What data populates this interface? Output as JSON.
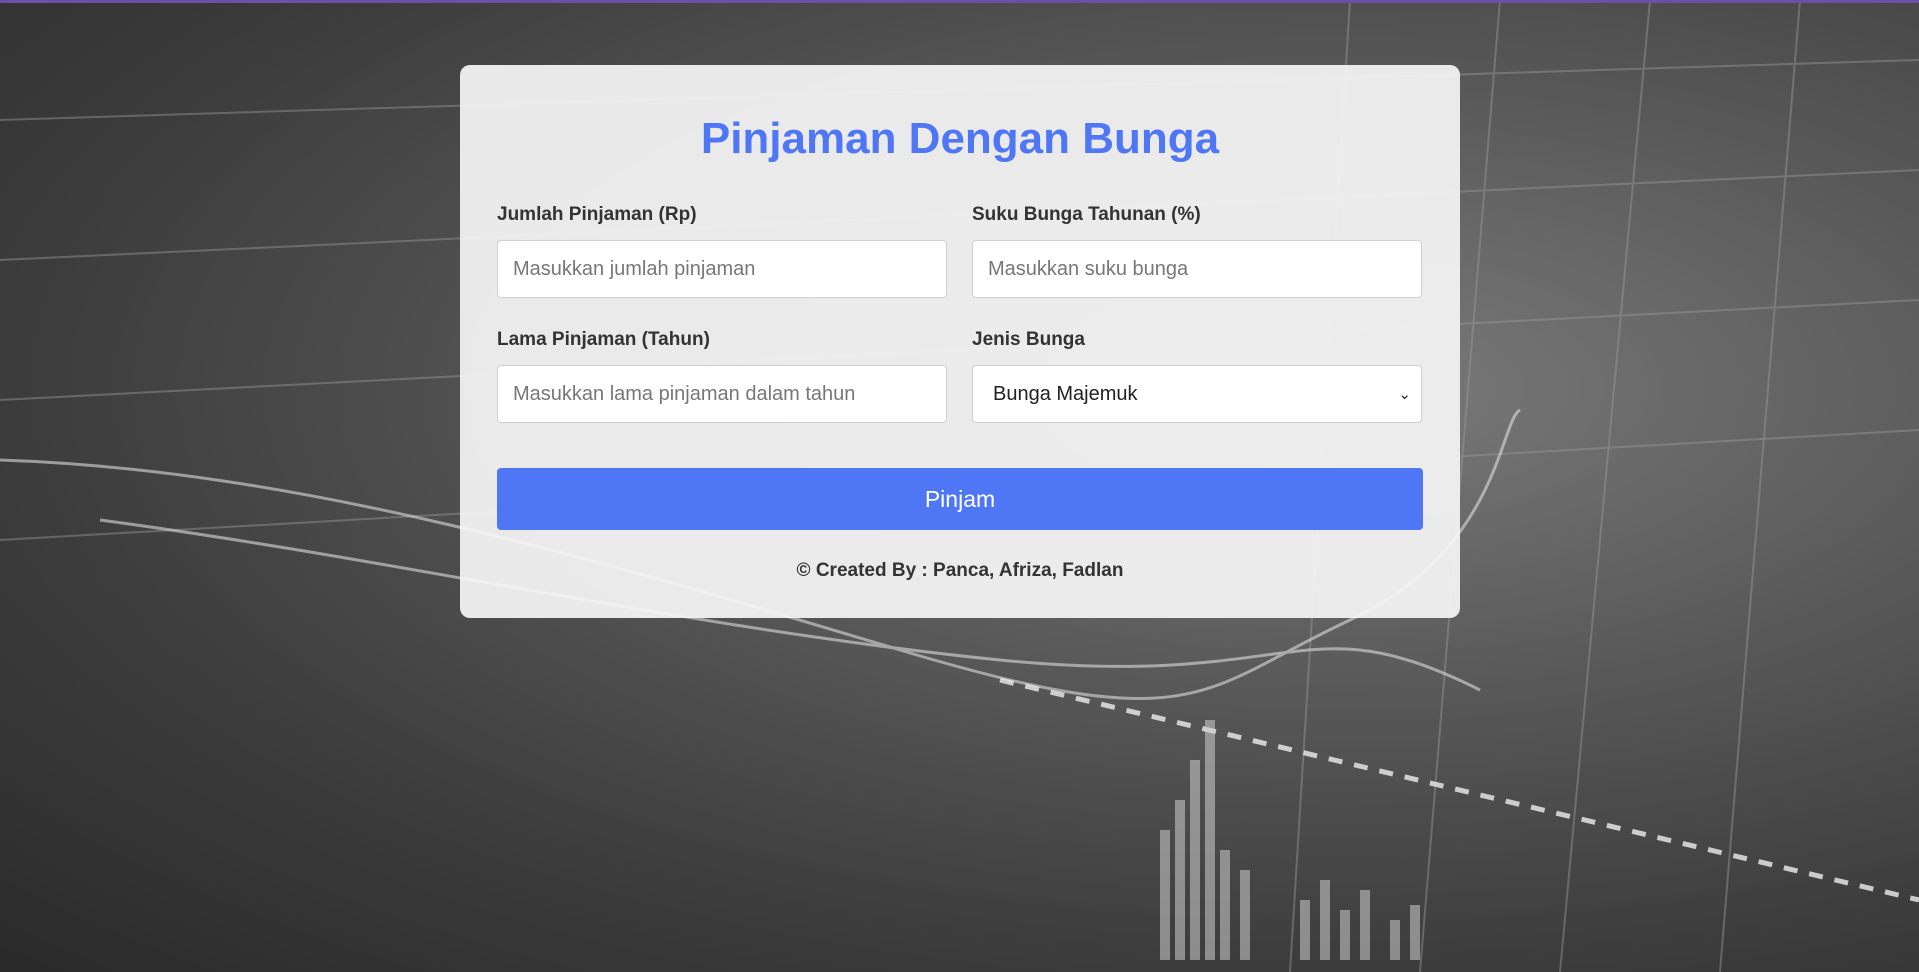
{
  "page": {
    "title": "Pinjaman Dengan Bunga"
  },
  "form": {
    "amount": {
      "label": "Jumlah Pinjaman (Rp)",
      "placeholder": "Masukkan jumlah pinjaman"
    },
    "rate": {
      "label": "Suku Bunga Tahunan (%)",
      "placeholder": "Masukkan suku bunga"
    },
    "duration": {
      "label": "Lama Pinjaman (Tahun)",
      "placeholder": "Masukkan lama pinjaman dalam tahun"
    },
    "interest_type": {
      "label": "Jenis Bunga",
      "selected": "Bunga Majemuk"
    },
    "submit_label": "Pinjam"
  },
  "footer": {
    "credit": "© Created By : Panca, Afriza, Fadlan"
  },
  "colors": {
    "accent": "#4f77f5",
    "top_bar": "#6b4fa8"
  }
}
